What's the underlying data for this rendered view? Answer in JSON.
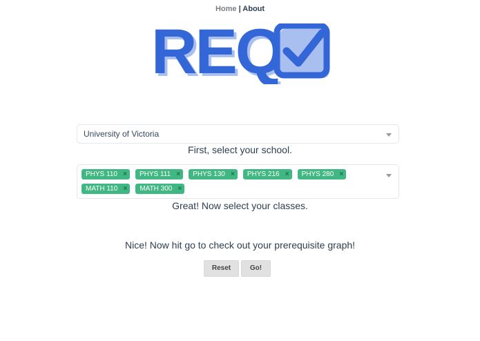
{
  "nav": {
    "home": "Home",
    "separator": "|",
    "about": "About"
  },
  "logo": {
    "text": "REQ",
    "icon": "checkbox-check-icon"
  },
  "school": {
    "selected": "University of Victoria",
    "hint": "First, select your school."
  },
  "classes": {
    "tags": [
      "PHYS 110",
      "PHYS 111",
      "PHYS 130",
      "PHYS 216",
      "PHYS 280",
      "MATH 110",
      "MATH 300"
    ],
    "remove_glyph": "×",
    "hint": "Great! Now select your classes."
  },
  "go_hint": "Nice! Now hit go to check out your prerequisite graph!",
  "buttons": {
    "reset": "Reset",
    "go": "Go!"
  },
  "colors": {
    "tag": "#41b883",
    "logo_blue": "#3366d6",
    "logo_shadow": "#a9bff0"
  }
}
